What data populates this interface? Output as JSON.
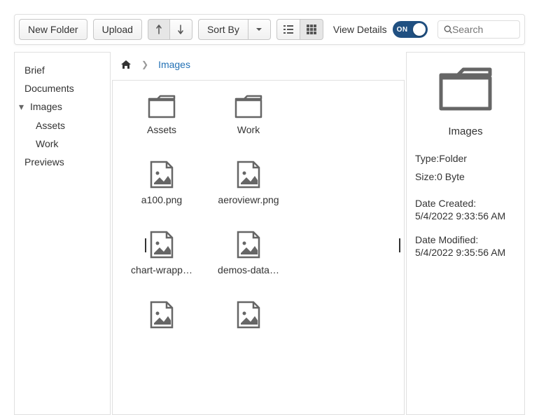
{
  "toolbar": {
    "new_folder": "New Folder",
    "upload": "Upload",
    "sort_by": "Sort By",
    "view_details": "View Details",
    "switch_on": "ON",
    "search_placeholder": "Search"
  },
  "tree": {
    "items": [
      {
        "label": "Brief",
        "indent": 1,
        "active": false,
        "caret": false
      },
      {
        "label": "Documents",
        "indent": 1,
        "active": false,
        "caret": false
      },
      {
        "label": "Images",
        "indent": 1,
        "active": true,
        "caret": true
      },
      {
        "label": "Assets",
        "indent": 2,
        "active": false,
        "caret": false
      },
      {
        "label": "Work",
        "indent": 2,
        "active": false,
        "caret": false
      },
      {
        "label": "Previews",
        "indent": 1,
        "active": false,
        "caret": false
      }
    ]
  },
  "breadcrumb": {
    "current": "Images"
  },
  "items": [
    {
      "name": "Assets",
      "type": "folder"
    },
    {
      "name": "Work",
      "type": "folder"
    },
    {
      "name": "a100.png",
      "type": "image"
    },
    {
      "name": "aeroviewr.png",
      "type": "image"
    },
    {
      "name": "chart-wrapp…",
      "type": "image"
    },
    {
      "name": "demos-data…",
      "type": "image"
    },
    {
      "name": "",
      "type": "image"
    },
    {
      "name": "",
      "type": "image"
    }
  ],
  "details": {
    "title": "Images",
    "type_label": "Type:",
    "type_value": "Folder",
    "size_label": "Size:",
    "size_value": "0 Byte",
    "created_label": "Date Created:",
    "created_value": "5/4/2022 9:33:56 AM",
    "modified_label": "Date Modified:",
    "modified_value": "5/4/2022 9:35:56 AM"
  }
}
